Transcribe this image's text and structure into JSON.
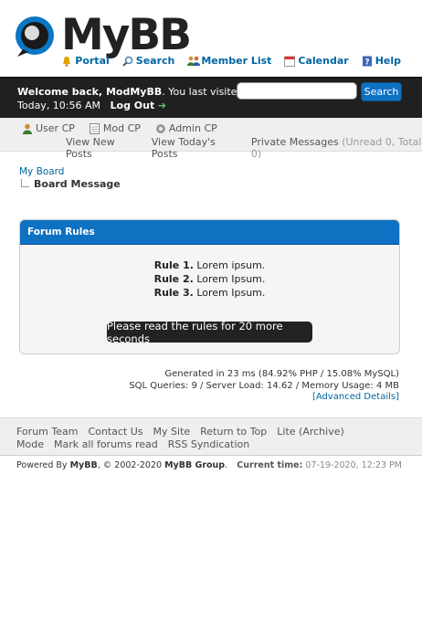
{
  "logo": {
    "text": "MyBB"
  },
  "toplinks": {
    "portal": "Portal",
    "search": "Search",
    "memberlist": "Member List",
    "calendar": "Calendar",
    "help": "Help"
  },
  "welcome": {
    "prefix": "Welcome back, ",
    "username": "ModMyBB",
    "suffix": ". You last visited:",
    "visited": "Today, 10:56 AM",
    "logout": "Log Out"
  },
  "search": {
    "button": "Search",
    "placeholder": ""
  },
  "panel": {
    "user_cp": "User CP",
    "mod_cp": "Mod CP",
    "admin_cp": "Admin CP",
    "new_posts": "View New Posts",
    "todays_posts": "View Today's Posts",
    "pm": "Private Messages",
    "pm_counts": "(Unread 0, Total 0)"
  },
  "breadcrumb": {
    "home": "My Board",
    "current": "Board Message"
  },
  "rules": {
    "title": "Forum Rules",
    "items": [
      {
        "label": "Rule 1.",
        "text": "Lorem ipsum."
      },
      {
        "label": "Rule 2.",
        "text": "Lorem Ipsum."
      },
      {
        "label": "Rule 3.",
        "text": "Lorem Ipsum."
      }
    ],
    "timer": "Please read the rules for 20 more seconds"
  },
  "stats": {
    "line1": "Generated in 23 ms (84.92% PHP / 15.08% MySQL)",
    "line2": "SQL Queries: 9 / Server Load: 14.62 / Memory Usage: 4 MB",
    "advanced": "[Advanced Details]"
  },
  "footer": {
    "links": [
      "Forum Team",
      "Contact Us",
      "My Site",
      "Return to Top",
      "Lite (Archive) Mode",
      "Mark all forums read",
      "RSS Syndication"
    ],
    "powered_prefix": "Powered By ",
    "powered_name": "MyBB",
    "powered_mid": ", © 2002-2020 ",
    "powered_group": "MyBB Group",
    "powered_end": ".",
    "current_time_label": "Current time:",
    "current_time": "07-19-2020, 12:23 PM"
  },
  "colors": {
    "accent": "#0f71c2",
    "welcome_bar": "#202020",
    "link": "#0066a2"
  }
}
